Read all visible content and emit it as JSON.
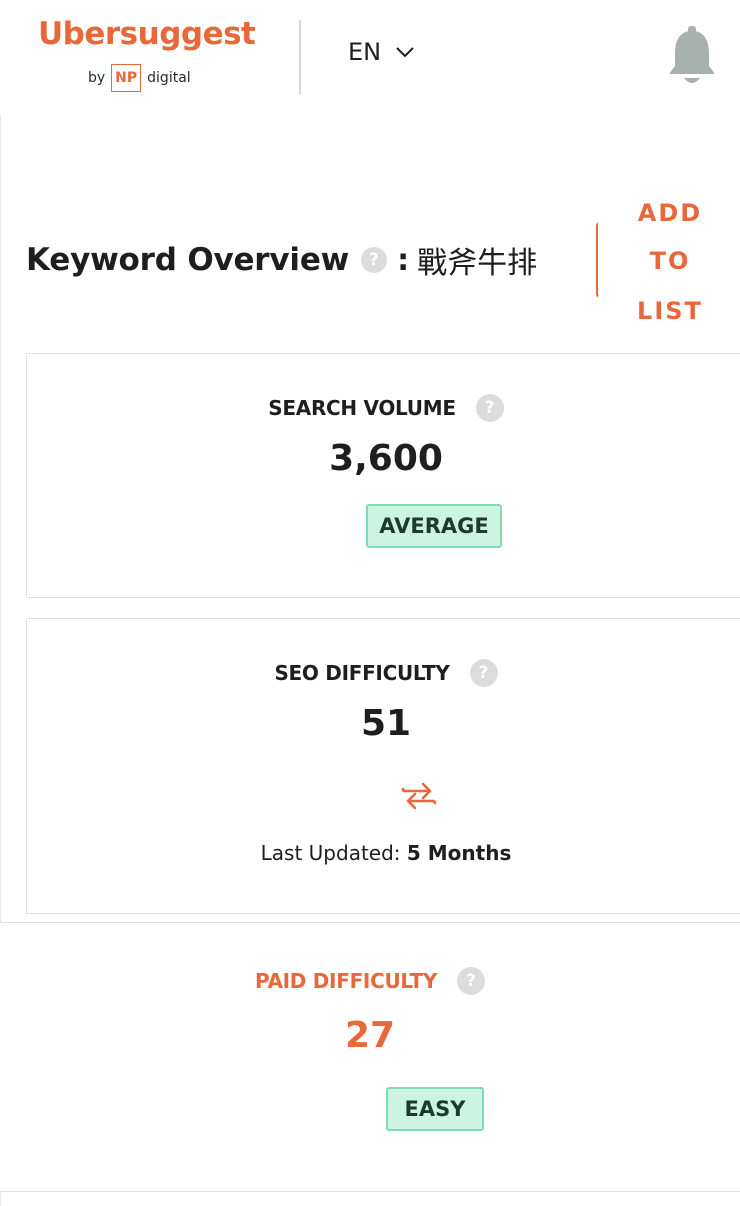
{
  "header": {
    "logo_name": "Ubersuggest",
    "logo_by": "by",
    "logo_np": "NP",
    "logo_digital": "digital",
    "language": "EN",
    "language_icon": "chevron-down-icon",
    "notifications_icon": "bell-icon"
  },
  "overview": {
    "title": "Keyword Overview",
    "help": "?",
    "colon": ":",
    "keyword": "戰斧牛排",
    "add_to_list": {
      "line1": "ADD",
      "line2": "TO",
      "line3": "LIST"
    }
  },
  "cards": {
    "search_volume": {
      "label": "SEARCH VOLUME",
      "help": "?",
      "value": "3,600",
      "badge": "AVERAGE"
    },
    "seo_difficulty": {
      "label": "SEO DIFFICULTY",
      "help": "?",
      "value": "51",
      "refresh_icon": "refresh-icon",
      "updated_label": "Last Updated:",
      "updated_value": "5 Months"
    },
    "paid_difficulty": {
      "label": "PAID DIFFICULTY",
      "help": "?",
      "value": "27",
      "badge": "EASY"
    }
  },
  "colors": {
    "brand": "#e8673b",
    "badge_bg": "#cdf3e2",
    "badge_border": "#7fdcb2",
    "help_icon": "#dcdcdc",
    "bell": "#a9b1ae"
  }
}
